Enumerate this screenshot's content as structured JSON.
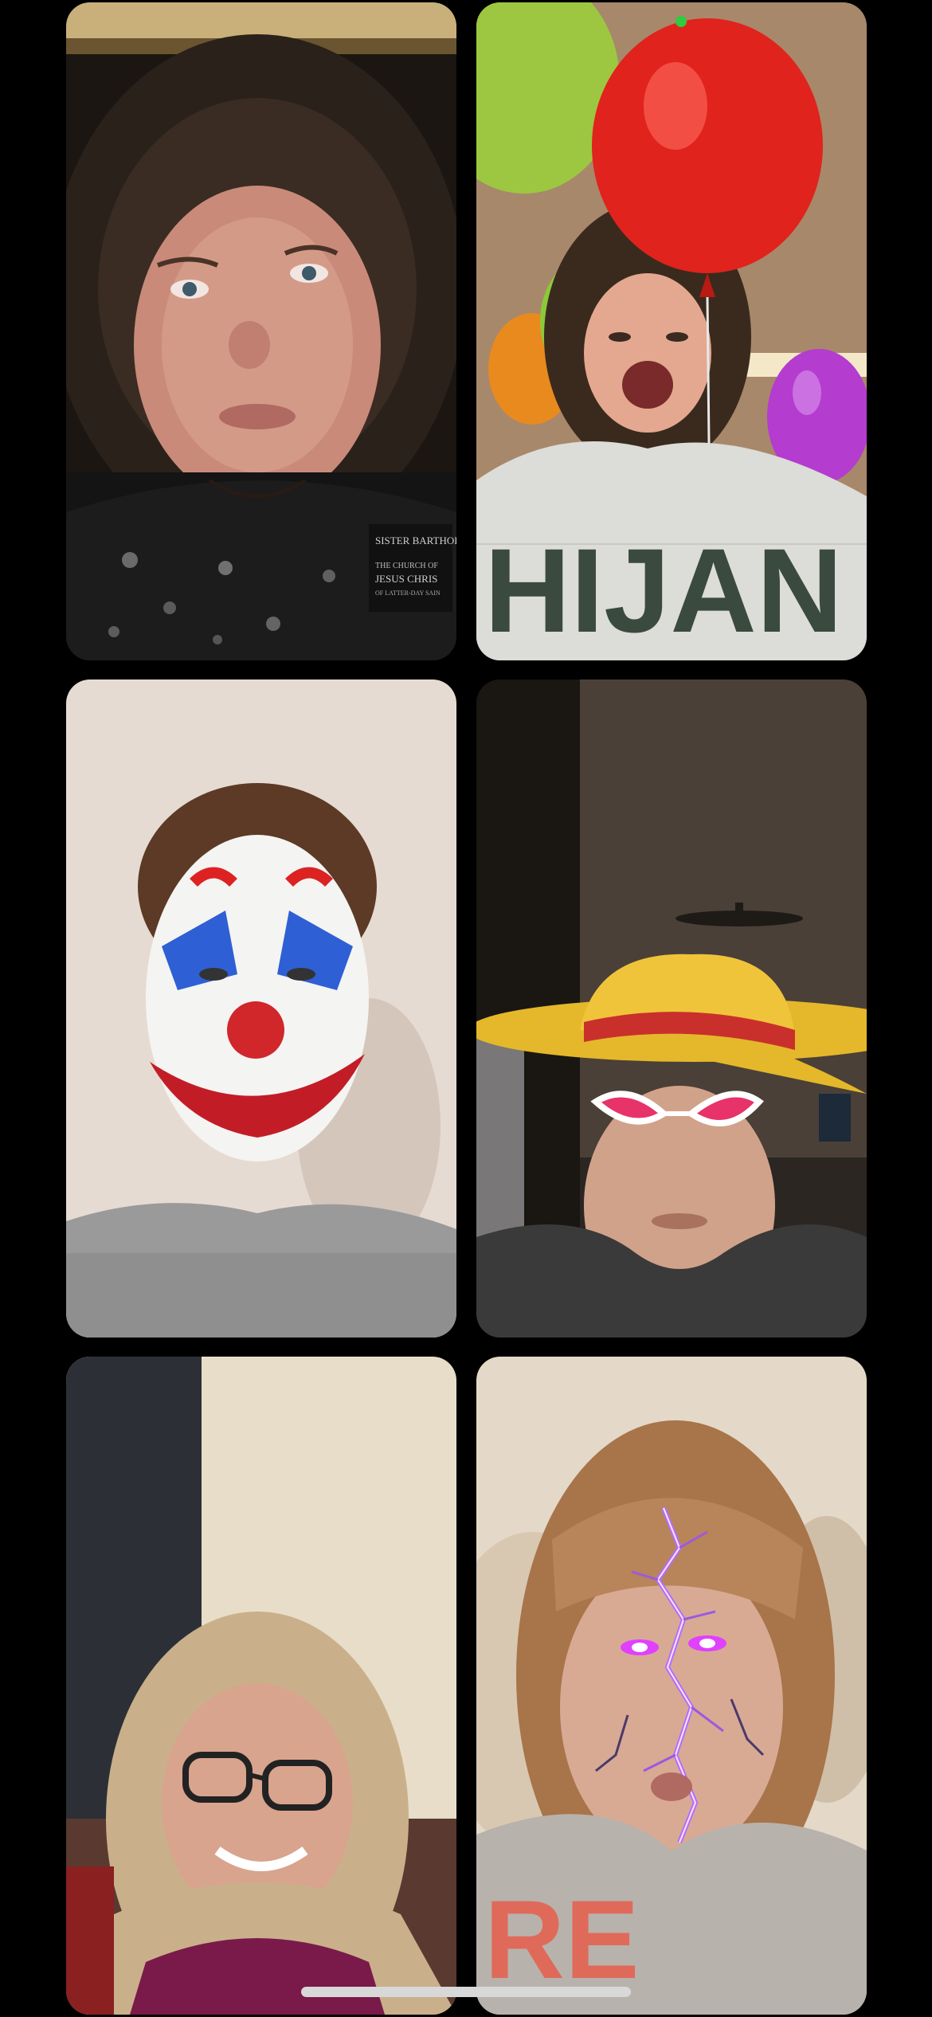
{
  "call": {
    "participants": [
      {
        "id": "p1",
        "effect": "none",
        "badge_lines": [
          "SISTER BARTHOLOM",
          "THE CHURCH OF",
          "JESUS CHRIS",
          "OF LATTER-DAY SAIN"
        ]
      },
      {
        "id": "p2",
        "effect": "balloons",
        "shirt_text": "HIJAN"
      },
      {
        "id": "p3",
        "effect": "clown-face-paint"
      },
      {
        "id": "p4",
        "effect": "straw-hat-and-pink-glasses"
      },
      {
        "id": "p5",
        "effect": "none"
      },
      {
        "id": "p6",
        "effect": "purple-lightning-face",
        "shirt_text": "RE"
      }
    ]
  },
  "colors": {
    "background": "#000000",
    "camera_indicator": "#2ecc40",
    "home_indicator": "#d8d8d8"
  }
}
